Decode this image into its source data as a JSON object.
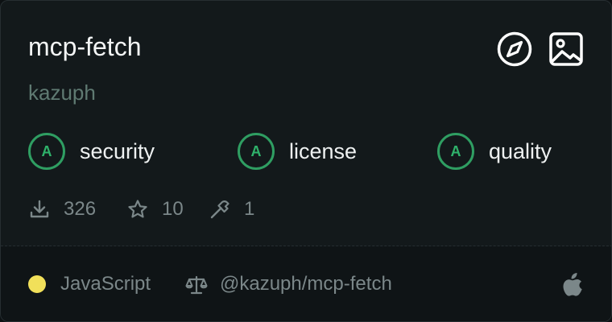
{
  "card": {
    "title": "mcp-fetch",
    "author": "kazuph",
    "header_icons": [
      "compass-icon",
      "image-icon"
    ],
    "grades": [
      {
        "grade": "A",
        "label": "security"
      },
      {
        "grade": "A",
        "label": "license"
      },
      {
        "grade": "A",
        "label": "quality"
      }
    ],
    "grade_color": "#2f9e62",
    "stats": {
      "downloads": "326",
      "stars": "10",
      "tools": "1"
    },
    "footer": {
      "language": "JavaScript",
      "language_color": "#f1e05a",
      "package": "@kazuph/mcp-fetch",
      "platform_icon": "apple-icon"
    }
  }
}
